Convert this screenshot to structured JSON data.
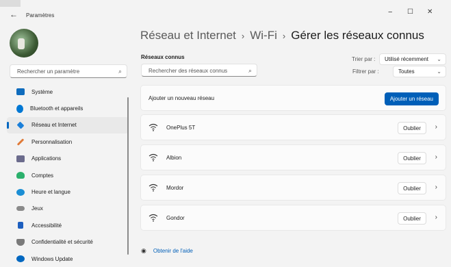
{
  "window": {
    "back_glyph": "←",
    "title": "Paramètres",
    "minimize": "−",
    "maximize": "☐",
    "close": "✕"
  },
  "sidebar": {
    "search_placeholder": "Rechercher un paramètre",
    "items": [
      {
        "label": "Système",
        "icon": "system-icon",
        "color": "#0f6cbd"
      },
      {
        "label": "Bluetooth et appareils",
        "icon": "bluetooth-icon",
        "color": "#0078d4"
      },
      {
        "label": "Réseau et Internet",
        "icon": "wifi-diamond-icon",
        "color": "#1a7fd9",
        "selected": true
      },
      {
        "label": "Personnalisation",
        "icon": "brush-icon",
        "color": "#e07b39"
      },
      {
        "label": "Applications",
        "icon": "apps-icon",
        "color": "#6b6b8c"
      },
      {
        "label": "Comptes",
        "icon": "person-icon",
        "color": "#2bb06c"
      },
      {
        "label": "Heure et langue",
        "icon": "globe-clock-icon",
        "color": "#1b8ed4"
      },
      {
        "label": "Jeux",
        "icon": "controller-icon",
        "color": "#8a8a8a"
      },
      {
        "label": "Accessibilité",
        "icon": "accessibility-icon",
        "color": "#1d5fbf"
      },
      {
        "label": "Confidentialité et sécurité",
        "icon": "shield-icon",
        "color": "#7a7a7a"
      },
      {
        "label": "Windows Update",
        "icon": "update-icon",
        "color": "#0067c0"
      }
    ]
  },
  "breadcrumb": {
    "part1": "Réseau et Internet",
    "part2": "Wi-Fi",
    "current": "Gérer les réseaux connus",
    "separator": "›"
  },
  "main": {
    "section_title": "Réseaux connus",
    "search_placeholder": "Rechercher des réseaux connus",
    "sort_label": "Trier par :",
    "sort_value": "Utilisé récemment",
    "filter_label": "Filtrer par :",
    "filter_value": "Toutes",
    "add_network_label": "Ajouter un nouveau réseau",
    "add_network_button": "Ajouter un réseau",
    "networks": [
      {
        "name": "OnePlus 5T",
        "forget": "Oublier"
      },
      {
        "name": "Albion",
        "forget": "Oublier"
      },
      {
        "name": "Mordor",
        "forget": "Oublier"
      },
      {
        "name": "Gondor",
        "forget": "Oublier"
      }
    ],
    "help": "Obtenir de l'aide"
  }
}
